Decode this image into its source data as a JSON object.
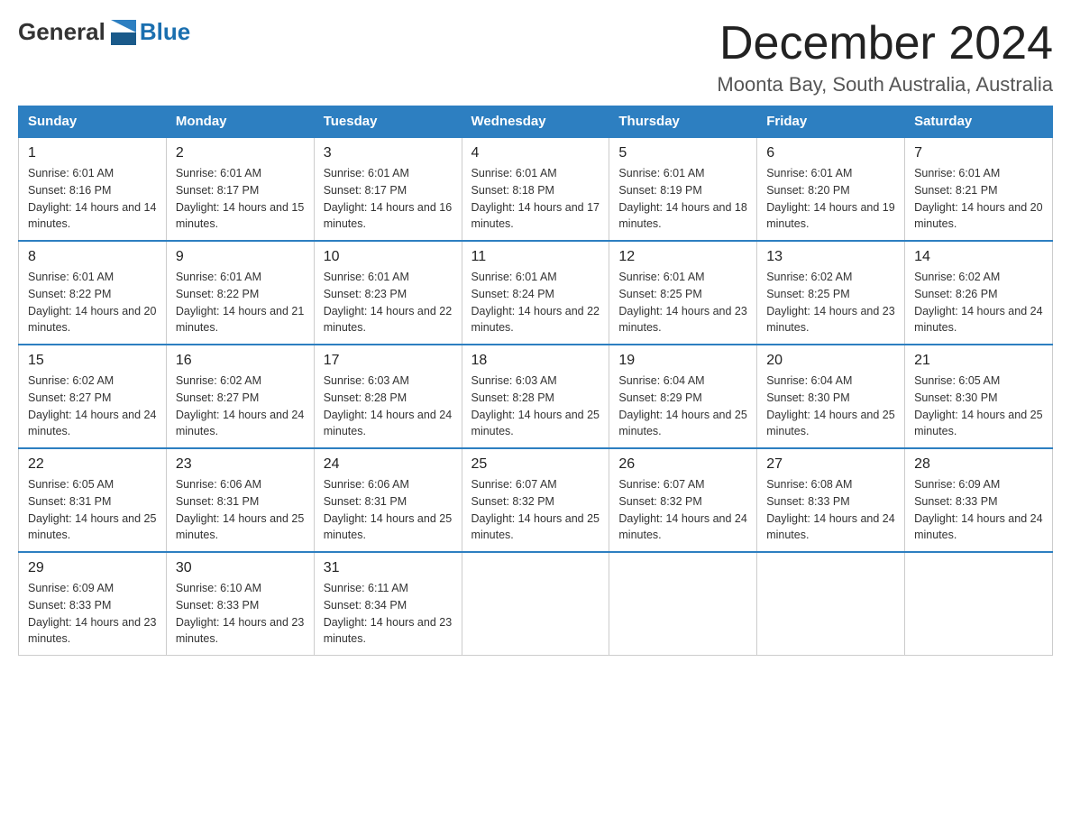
{
  "logo": {
    "general": "General",
    "blue": "Blue"
  },
  "header": {
    "month": "December 2024",
    "location": "Moonta Bay, South Australia, Australia"
  },
  "days_of_week": [
    "Sunday",
    "Monday",
    "Tuesday",
    "Wednesday",
    "Thursday",
    "Friday",
    "Saturday"
  ],
  "weeks": [
    [
      {
        "day": "1",
        "sunrise": "6:01 AM",
        "sunset": "8:16 PM",
        "daylight": "14 hours and 14 minutes."
      },
      {
        "day": "2",
        "sunrise": "6:01 AM",
        "sunset": "8:17 PM",
        "daylight": "14 hours and 15 minutes."
      },
      {
        "day": "3",
        "sunrise": "6:01 AM",
        "sunset": "8:17 PM",
        "daylight": "14 hours and 16 minutes."
      },
      {
        "day": "4",
        "sunrise": "6:01 AM",
        "sunset": "8:18 PM",
        "daylight": "14 hours and 17 minutes."
      },
      {
        "day": "5",
        "sunrise": "6:01 AM",
        "sunset": "8:19 PM",
        "daylight": "14 hours and 18 minutes."
      },
      {
        "day": "6",
        "sunrise": "6:01 AM",
        "sunset": "8:20 PM",
        "daylight": "14 hours and 19 minutes."
      },
      {
        "day": "7",
        "sunrise": "6:01 AM",
        "sunset": "8:21 PM",
        "daylight": "14 hours and 20 minutes."
      }
    ],
    [
      {
        "day": "8",
        "sunrise": "6:01 AM",
        "sunset": "8:22 PM",
        "daylight": "14 hours and 20 minutes."
      },
      {
        "day": "9",
        "sunrise": "6:01 AM",
        "sunset": "8:22 PM",
        "daylight": "14 hours and 21 minutes."
      },
      {
        "day": "10",
        "sunrise": "6:01 AM",
        "sunset": "8:23 PM",
        "daylight": "14 hours and 22 minutes."
      },
      {
        "day": "11",
        "sunrise": "6:01 AM",
        "sunset": "8:24 PM",
        "daylight": "14 hours and 22 minutes."
      },
      {
        "day": "12",
        "sunrise": "6:01 AM",
        "sunset": "8:25 PM",
        "daylight": "14 hours and 23 minutes."
      },
      {
        "day": "13",
        "sunrise": "6:02 AM",
        "sunset": "8:25 PM",
        "daylight": "14 hours and 23 minutes."
      },
      {
        "day": "14",
        "sunrise": "6:02 AM",
        "sunset": "8:26 PM",
        "daylight": "14 hours and 24 minutes."
      }
    ],
    [
      {
        "day": "15",
        "sunrise": "6:02 AM",
        "sunset": "8:27 PM",
        "daylight": "14 hours and 24 minutes."
      },
      {
        "day": "16",
        "sunrise": "6:02 AM",
        "sunset": "8:27 PM",
        "daylight": "14 hours and 24 minutes."
      },
      {
        "day": "17",
        "sunrise": "6:03 AM",
        "sunset": "8:28 PM",
        "daylight": "14 hours and 24 minutes."
      },
      {
        "day": "18",
        "sunrise": "6:03 AM",
        "sunset": "8:28 PM",
        "daylight": "14 hours and 25 minutes."
      },
      {
        "day": "19",
        "sunrise": "6:04 AM",
        "sunset": "8:29 PM",
        "daylight": "14 hours and 25 minutes."
      },
      {
        "day": "20",
        "sunrise": "6:04 AM",
        "sunset": "8:30 PM",
        "daylight": "14 hours and 25 minutes."
      },
      {
        "day": "21",
        "sunrise": "6:05 AM",
        "sunset": "8:30 PM",
        "daylight": "14 hours and 25 minutes."
      }
    ],
    [
      {
        "day": "22",
        "sunrise": "6:05 AM",
        "sunset": "8:31 PM",
        "daylight": "14 hours and 25 minutes."
      },
      {
        "day": "23",
        "sunrise": "6:06 AM",
        "sunset": "8:31 PM",
        "daylight": "14 hours and 25 minutes."
      },
      {
        "day": "24",
        "sunrise": "6:06 AM",
        "sunset": "8:31 PM",
        "daylight": "14 hours and 25 minutes."
      },
      {
        "day": "25",
        "sunrise": "6:07 AM",
        "sunset": "8:32 PM",
        "daylight": "14 hours and 25 minutes."
      },
      {
        "day": "26",
        "sunrise": "6:07 AM",
        "sunset": "8:32 PM",
        "daylight": "14 hours and 24 minutes."
      },
      {
        "day": "27",
        "sunrise": "6:08 AM",
        "sunset": "8:33 PM",
        "daylight": "14 hours and 24 minutes."
      },
      {
        "day": "28",
        "sunrise": "6:09 AM",
        "sunset": "8:33 PM",
        "daylight": "14 hours and 24 minutes."
      }
    ],
    [
      {
        "day": "29",
        "sunrise": "6:09 AM",
        "sunset": "8:33 PM",
        "daylight": "14 hours and 23 minutes."
      },
      {
        "day": "30",
        "sunrise": "6:10 AM",
        "sunset": "8:33 PM",
        "daylight": "14 hours and 23 minutes."
      },
      {
        "day": "31",
        "sunrise": "6:11 AM",
        "sunset": "8:34 PM",
        "daylight": "14 hours and 23 minutes."
      },
      null,
      null,
      null,
      null
    ]
  ]
}
